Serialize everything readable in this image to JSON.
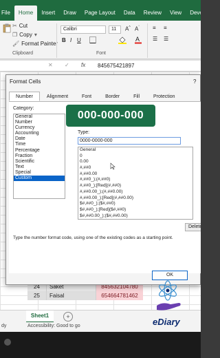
{
  "ribbon": {
    "tabs": [
      "File",
      "Home",
      "Insert",
      "Draw",
      "Page Layout",
      "Data",
      "Review",
      "View",
      "Developer"
    ],
    "active_tab": "Home",
    "clipboard": {
      "cut": "Cut",
      "copy": "Copy",
      "format_painter": "Format Painter",
      "group_label": "Clipboard"
    },
    "font": {
      "name": "Calibri",
      "size": "11",
      "group_label": "Font"
    }
  },
  "formula_bar": {
    "fx": "fx",
    "value": "845675421897"
  },
  "dialog": {
    "title": "Format Cells",
    "help": "?",
    "tabs": [
      "Number",
      "Alignment",
      "Font",
      "Border",
      "Fill",
      "Protection"
    ],
    "active_tab": "Number",
    "category_label": "Category:",
    "categories": [
      "General",
      "Number",
      "Currency",
      "Accounting",
      "Date",
      "Time",
      "Percentage",
      "Fraction",
      "Scientific",
      "Text",
      "Special",
      "Custom"
    ],
    "selected_category": "Custom",
    "type_label": "Type:",
    "type_value": "0000-0000-000",
    "format_codes": [
      "General",
      "0",
      "0.00",
      "#,##0",
      "#,##0.00",
      "#,##0_);(#,##0)",
      "#,##0_);[Red](#,##0)",
      "#,##0.00_);(#,##0.00)",
      "#,##0.00_);[Red](#,##0.00)",
      "$#,##0_);($#,##0)",
      "$#,##0_);[Red]($#,##0)",
      "$#,##0.00_);($#,##0.00)"
    ],
    "delete_label": "Delete",
    "hint": "Type the number format code, using one of the existing codes as a starting point.",
    "ok_label": "OK"
  },
  "callout": "000-000-000",
  "rows": [
    {
      "num": "24",
      "name": "Saket",
      "phone": "845632104780"
    },
    {
      "num": "25",
      "name": "Faisal",
      "phone": "654664781462"
    }
  ],
  "sheet_tab": "Sheet1",
  "status": {
    "ready": "dy",
    "accessibility": "Accessibility: Good to go"
  },
  "watermark": "eDiary",
  "colors": {
    "excel_green": "#1f6b3f",
    "callout_green": "#1b7048",
    "selection_blue": "#0a64c8"
  }
}
